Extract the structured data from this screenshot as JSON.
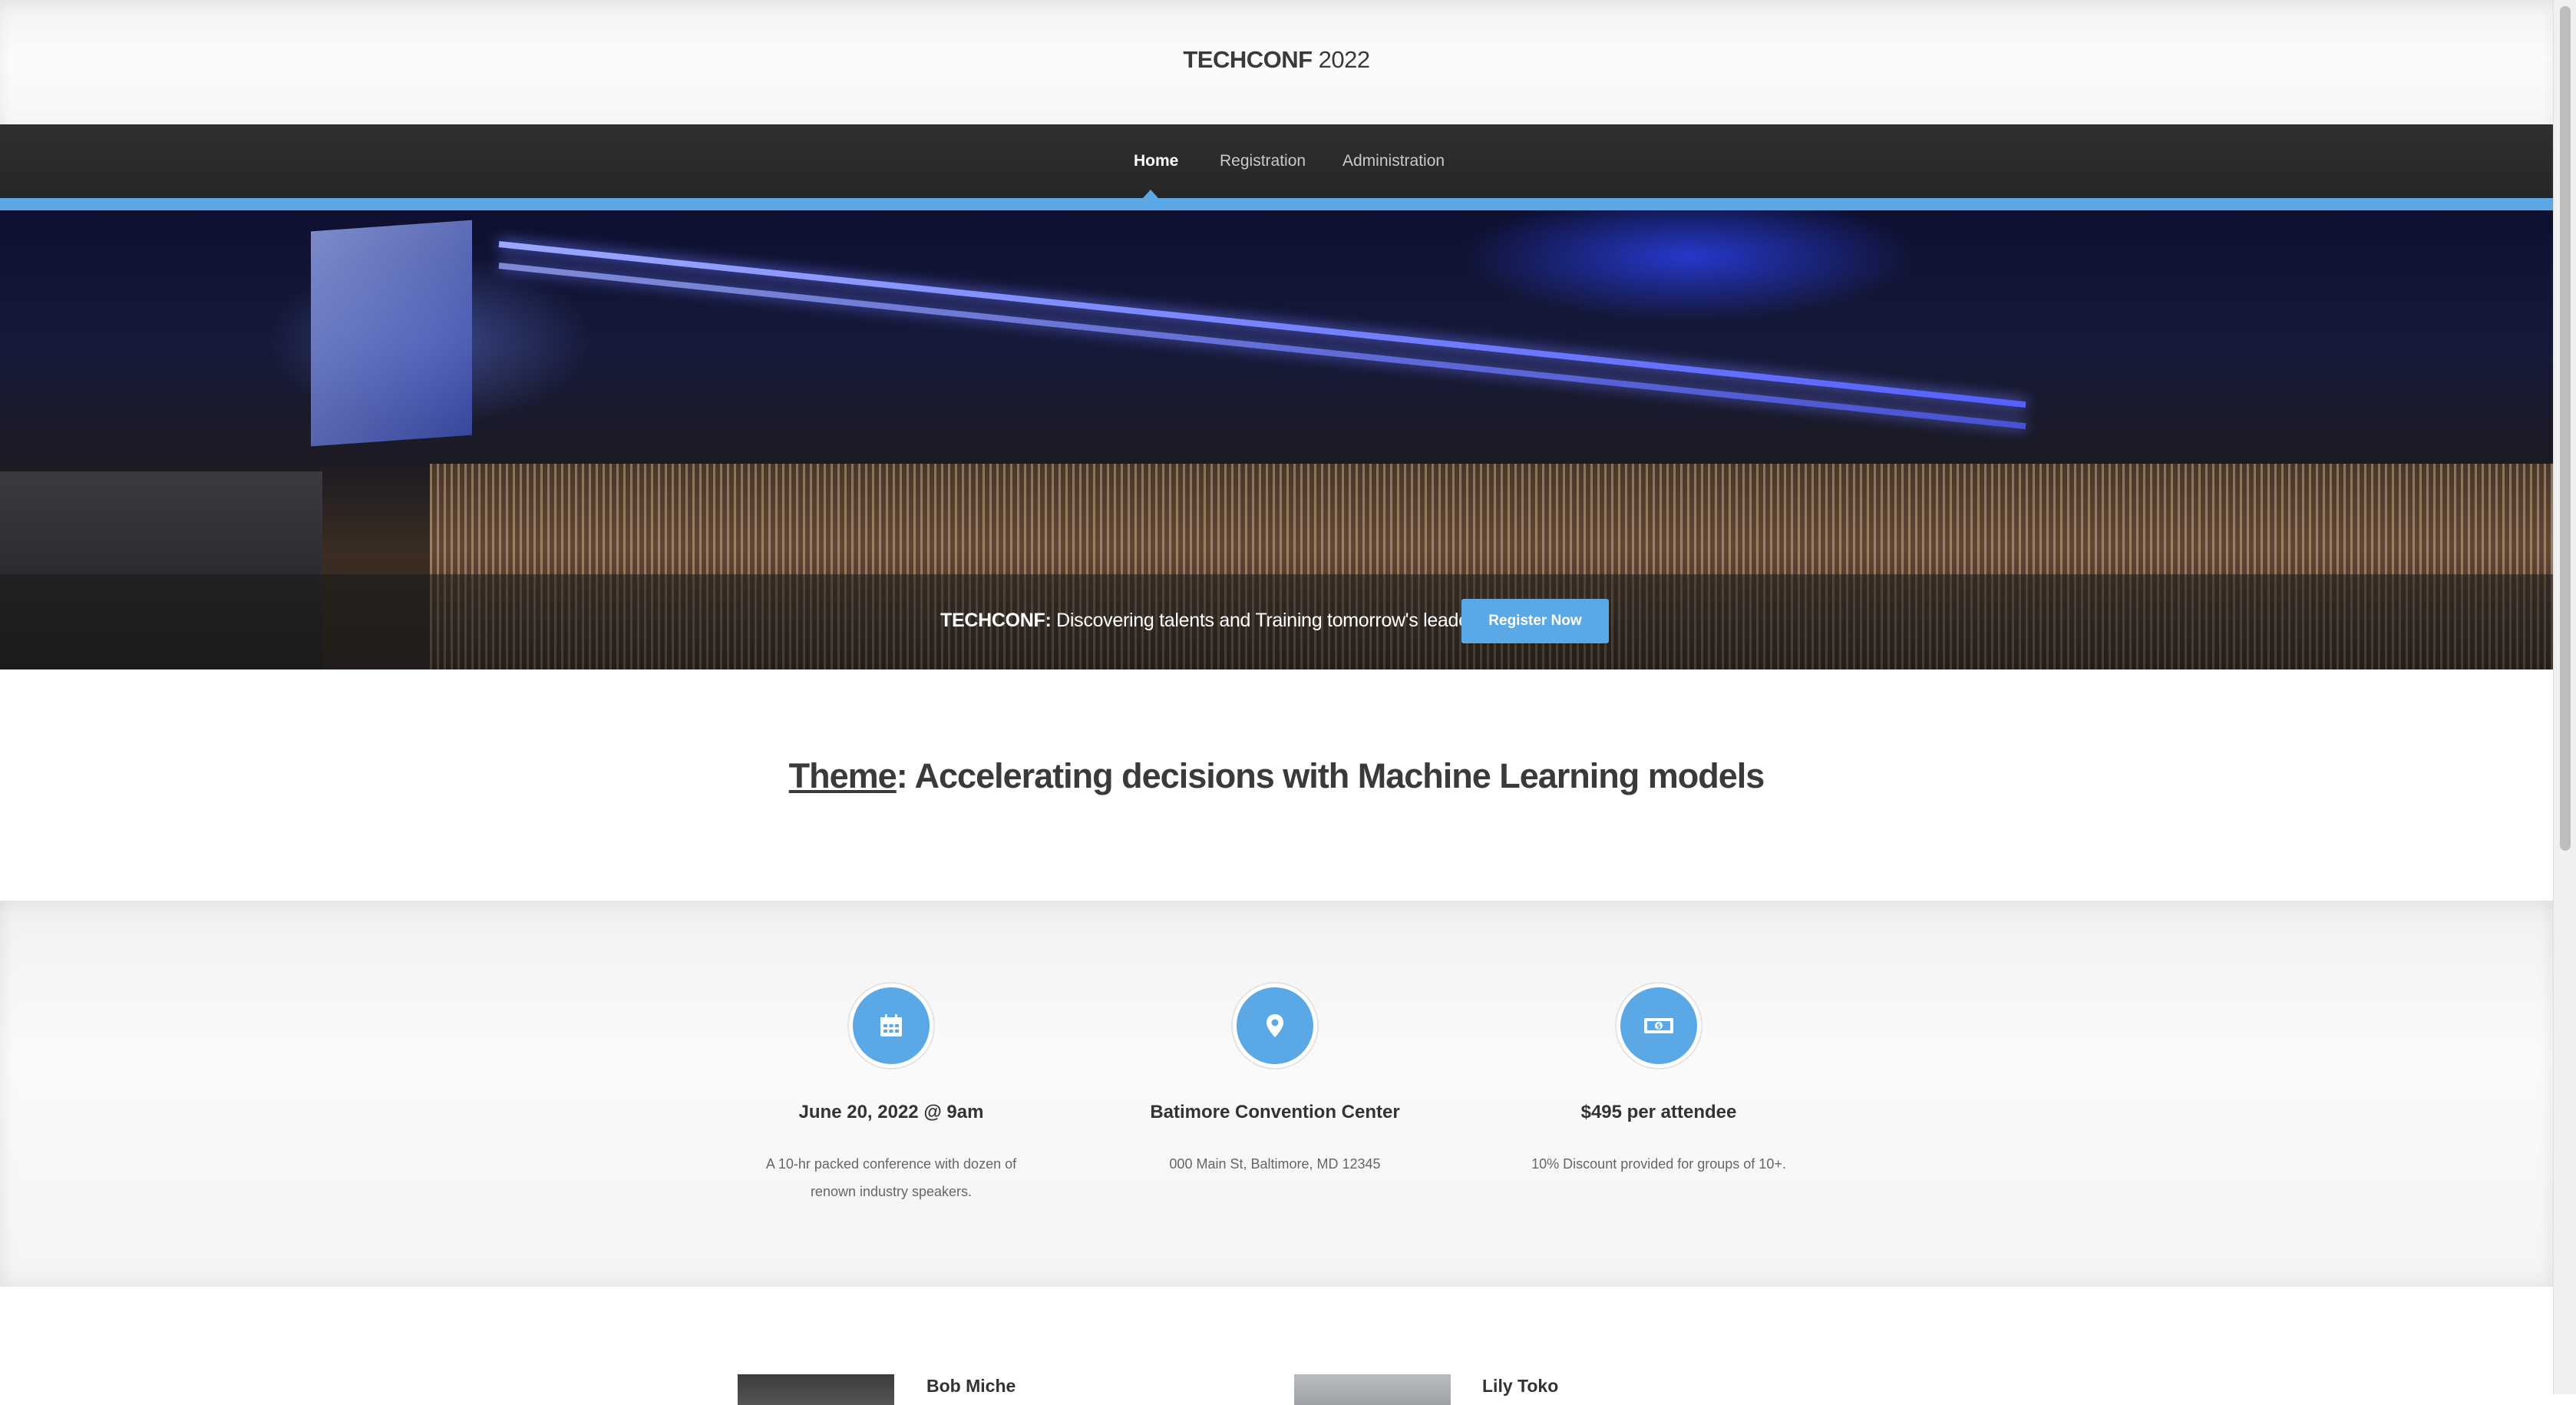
{
  "header": {
    "brand": "TECHCONF",
    "year": " 2022"
  },
  "nav": {
    "items": [
      {
        "label": "Home",
        "active": true
      },
      {
        "label": "Registration",
        "active": false
      },
      {
        "label": "Administration",
        "active": false
      }
    ]
  },
  "hero": {
    "caption_brand": "TECHCONF:",
    "caption_text": " Discovering talents and Training tomorrow's leaders",
    "register_label": "Register Now"
  },
  "theme": {
    "label": "Theme",
    "text": ": Accelerating decisions with Machine Learning models"
  },
  "features": [
    {
      "icon": "calendar-icon",
      "title": "June 20, 2022 @ 9am",
      "description": "A 10-hr packed conference with dozen of renown industry speakers."
    },
    {
      "icon": "map-pin-icon",
      "title": "Batimore Convention Center",
      "description": "000 Main St, Baltimore, MD 12345"
    },
    {
      "icon": "money-icon",
      "title": "$495 per attendee",
      "description": "10% Discount provided for groups of 10+."
    }
  ],
  "speakers": [
    {
      "name": "Bob Miche"
    },
    {
      "name": "Lily Toko"
    }
  ],
  "colors": {
    "accent": "#5aa9e6",
    "nav_bg": "#2b2b2b"
  }
}
